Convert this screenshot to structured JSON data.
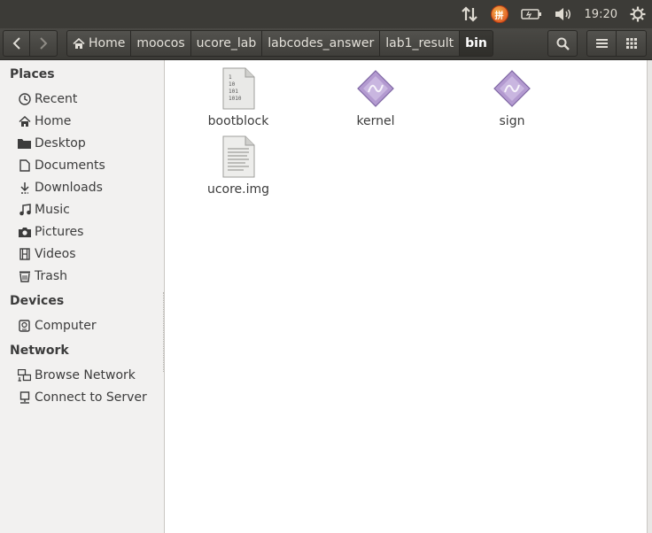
{
  "panel": {
    "clock": "19:20",
    "ime_label": "拼"
  },
  "toolbar": {
    "path": [
      "Home",
      "moocos",
      "ucore_lab",
      "labcodes_answer",
      "lab1_result",
      "bin"
    ]
  },
  "sidebar": {
    "sections": [
      {
        "heading": "Places",
        "items": [
          "Recent",
          "Home",
          "Desktop",
          "Documents",
          "Downloads",
          "Music",
          "Pictures",
          "Videos",
          "Trash"
        ]
      },
      {
        "heading": "Devices",
        "items": [
          "Computer"
        ]
      },
      {
        "heading": "Network",
        "items": [
          "Browse Network",
          "Connect to Server"
        ]
      }
    ]
  },
  "files": [
    {
      "name": "bootblock",
      "icon": "binary-file-icon"
    },
    {
      "name": "kernel",
      "icon": "executable-icon"
    },
    {
      "name": "sign",
      "icon": "executable-icon"
    },
    {
      "name": "ucore.img",
      "icon": "text-file-icon"
    }
  ],
  "colors": {
    "panel_bg": "#3c3b37",
    "sidebar_bg": "#f2f1f0",
    "exec_icon": "#b39ad0"
  }
}
